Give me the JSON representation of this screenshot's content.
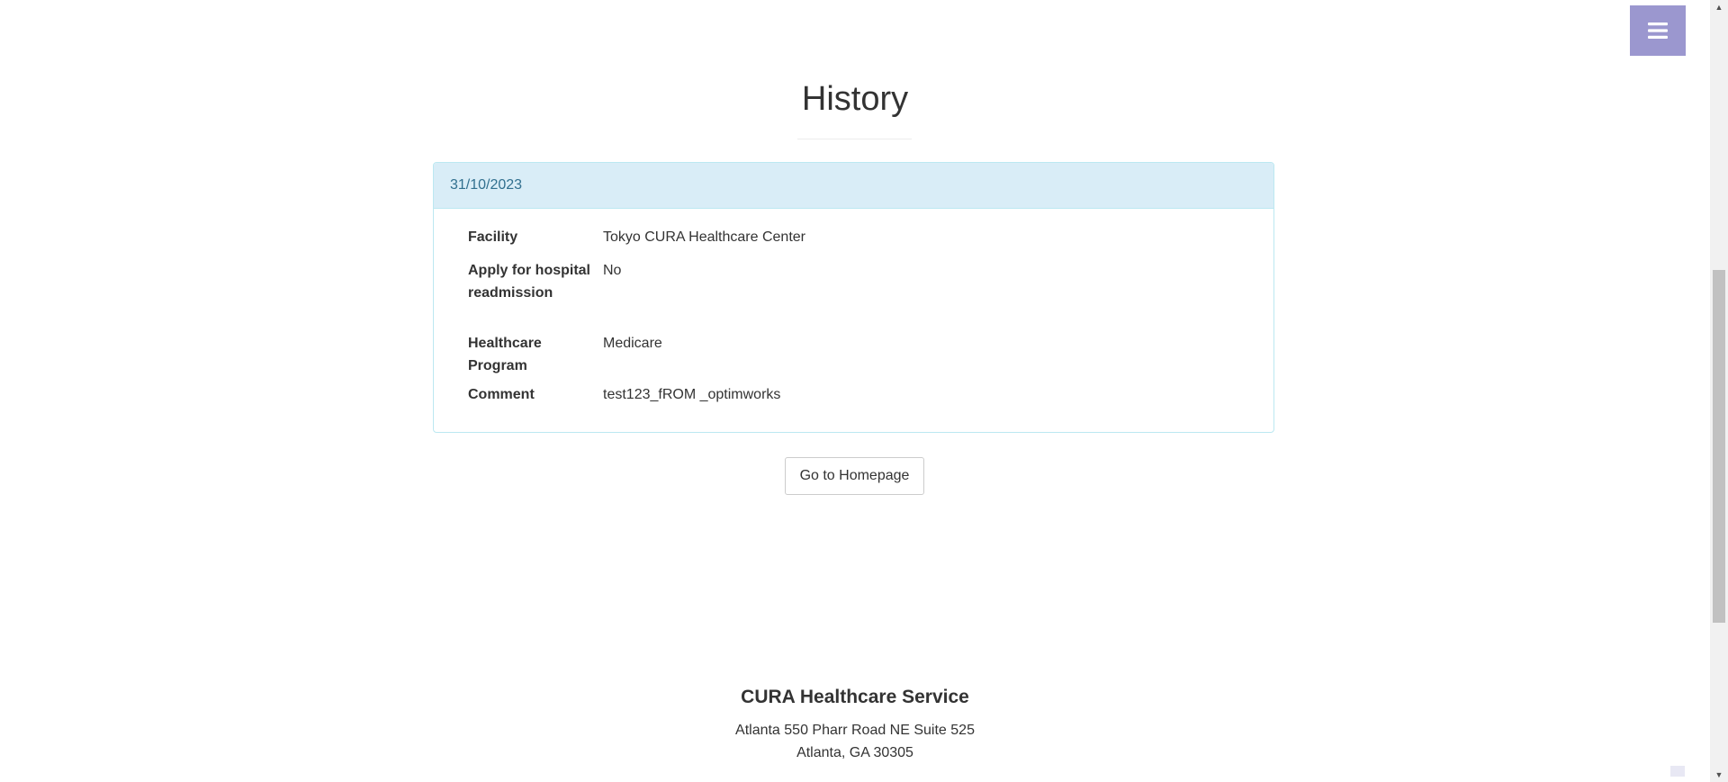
{
  "menu": {
    "icon": "hamburger-menu-icon",
    "bg_color": "#9b97cf"
  },
  "page": {
    "title": "History"
  },
  "history": {
    "date": "31/10/2023",
    "heading_color": "#d9edf7",
    "rows": [
      {
        "label": "Facility",
        "value": "Tokyo CURA Healthcare Center"
      },
      {
        "label": "Apply for hospital readmission",
        "value": "No"
      },
      {
        "label": "Healthcare Program",
        "value": "Medicare"
      },
      {
        "label": "Comment",
        "value": "test123_fROM _optimworks"
      }
    ]
  },
  "actions": {
    "home_button": "Go to Homepage"
  },
  "footer": {
    "company": "CURA Healthcare Service",
    "address_line1": "Atlanta 550 Pharr Road NE Suite 525",
    "address_line2": "Atlanta, GA 30305"
  }
}
